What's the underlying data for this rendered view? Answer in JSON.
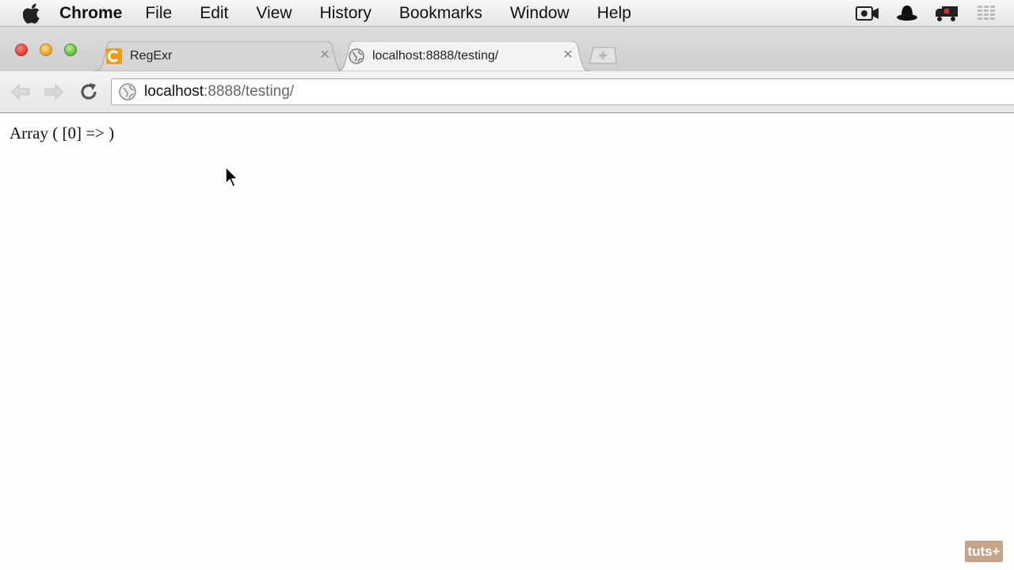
{
  "menubar": {
    "app_name": "Chrome",
    "items": [
      "File",
      "Edit",
      "View",
      "History",
      "Bookmarks",
      "Window",
      "Help"
    ],
    "tray_icons": [
      "camera-icon",
      "hat-icon",
      "truck-icon",
      "grid-icon"
    ]
  },
  "tabs": [
    {
      "title": "RegExr",
      "icon": "regexr-favicon",
      "active": false
    },
    {
      "title": "localhost:8888/testing/",
      "icon": "globe-icon",
      "active": true
    }
  ],
  "omnibox": {
    "host": "localhost",
    "path": ":8888/testing/"
  },
  "page": {
    "output": "Array ( [0] => )"
  },
  "watermark": {
    "text": "tuts+"
  },
  "colors": {
    "regexr_orange": "#f39c12",
    "watermark_bg": "#c4a58a"
  }
}
